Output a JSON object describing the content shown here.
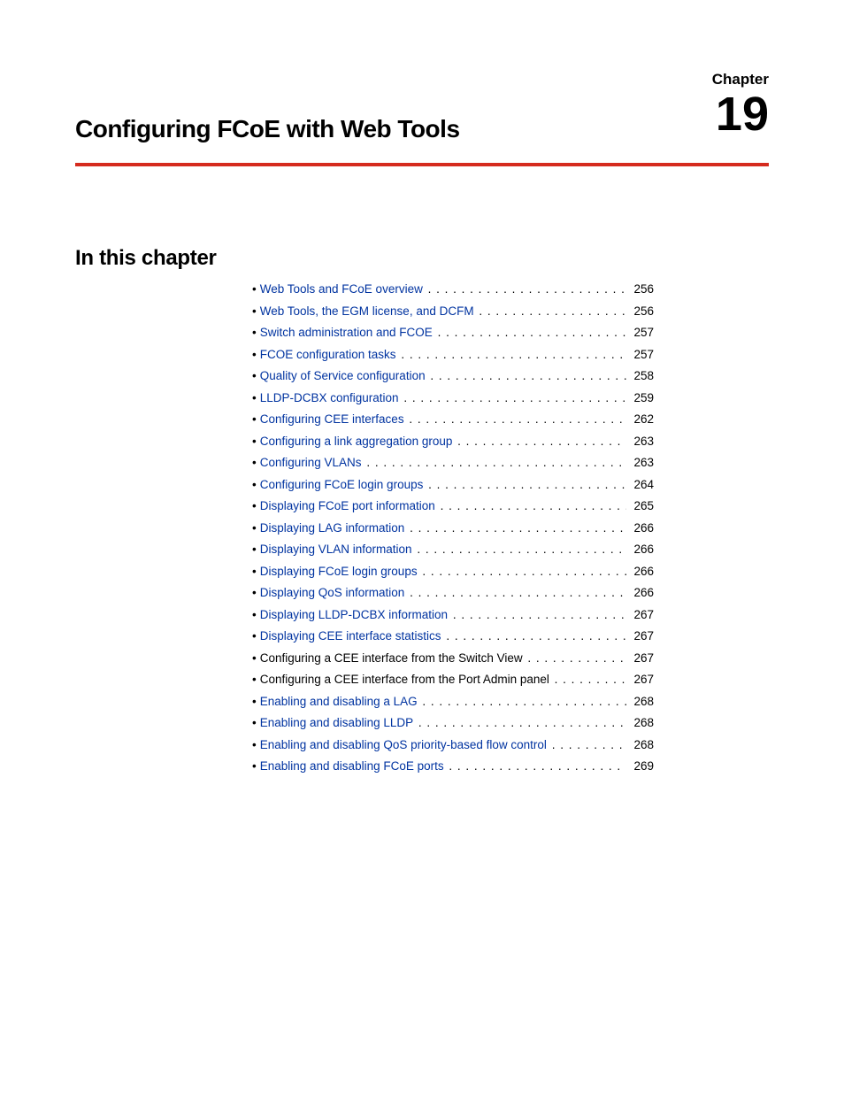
{
  "header": {
    "chapter_label": "Chapter",
    "chapter_number": "19",
    "chapter_title": "Configuring FCoE with Web Tools"
  },
  "section_heading": "In this chapter",
  "toc": [
    {
      "title": "Web Tools and FCoE overview",
      "page": "256",
      "link": true
    },
    {
      "title": "Web Tools, the EGM license, and DCFM",
      "page": "256",
      "link": true
    },
    {
      "title": "Switch administration and FCOE",
      "page": "257",
      "link": true
    },
    {
      "title": "FCOE configuration tasks",
      "page": "257",
      "link": true
    },
    {
      "title": "Quality of Service configuration",
      "page": "258",
      "link": true
    },
    {
      "title": "LLDP-DCBX configuration",
      "page": "259",
      "link": true
    },
    {
      "title": "Configuring CEE interfaces",
      "page": "262",
      "link": true
    },
    {
      "title": "Configuring a link aggregation group",
      "page": "263",
      "link": true
    },
    {
      "title": "Configuring VLANs",
      "page": "263",
      "link": true
    },
    {
      "title": "Configuring FCoE login groups",
      "page": "264",
      "link": true
    },
    {
      "title": "Displaying FCoE port information",
      "page": "265",
      "link": true
    },
    {
      "title": "Displaying LAG information",
      "page": "266",
      "link": true
    },
    {
      "title": "Displaying VLAN information",
      "page": "266",
      "link": true
    },
    {
      "title": "Displaying FCoE login groups",
      "page": "266",
      "link": true
    },
    {
      "title": "Displaying QoS information",
      "page": "266",
      "link": true
    },
    {
      "title": "Displaying LLDP-DCBX information",
      "page": "267",
      "link": true
    },
    {
      "title": "Displaying CEE interface statistics",
      "page": "267",
      "link": true
    },
    {
      "title": "Configuring a CEE interface from the Switch View",
      "page": "267",
      "link": false
    },
    {
      "title": "Configuring a CEE interface from the Port Admin panel",
      "page": "267",
      "link": false
    },
    {
      "title": "Enabling and disabling a LAG",
      "page": "268",
      "link": true
    },
    {
      "title": "Enabling and disabling LLDP",
      "page": "268",
      "link": true
    },
    {
      "title": "Enabling and disabling QoS priority-based flow control",
      "page": "268",
      "link": true
    },
    {
      "title": "Enabling and disabling FCoE ports",
      "page": "269",
      "link": true
    }
  ]
}
